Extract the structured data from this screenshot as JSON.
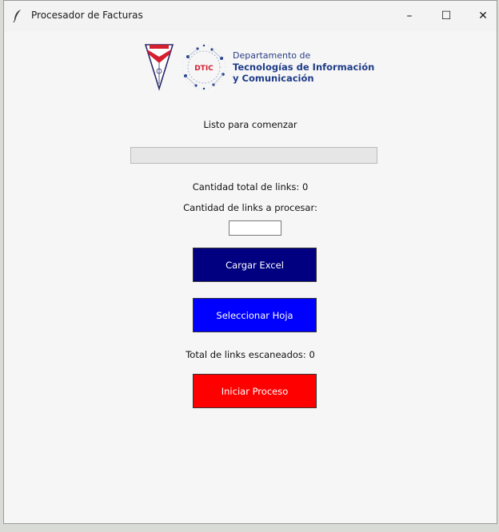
{
  "window": {
    "title": "Procesador de Facturas",
    "controls": {
      "minimize": "–",
      "maximize": "☐",
      "close": "✕"
    }
  },
  "logo": {
    "line1": "Departamento de",
    "line2": "Tecnologías de Información",
    "line3": "y Comunicación",
    "badge": "DTIC",
    "shield_text": "UNSE"
  },
  "status": {
    "message": "Listo para comenzar",
    "progress": 0
  },
  "counts": {
    "total_links_label": "Cantidad total de links: 0",
    "to_process_label": "Cantidad de links a procesar:",
    "to_process_value": "",
    "scanned_label": "Total de links escaneados: 0"
  },
  "buttons": {
    "cargar_excel": "Cargar Excel",
    "seleccionar_hoja": "Seleccionar Hoja",
    "iniciar_proceso": "Iniciar Proceso"
  },
  "colors": {
    "cargar_excel": "#000080",
    "seleccionar_hoja": "#0000ff",
    "iniciar_proceso": "#ff0000",
    "logo_text": "#1f3c88"
  },
  "icons": {
    "app_icon": "feather-icon"
  }
}
